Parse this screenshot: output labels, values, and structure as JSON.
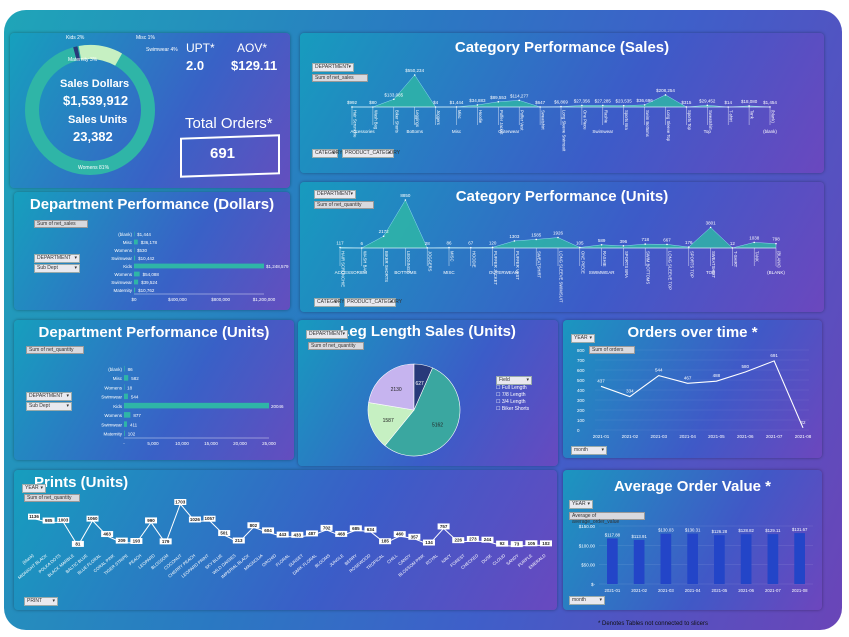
{
  "kpi": {
    "sales_dollars_label": "Sales Dollars",
    "sales_dollars_value": "$1,539,912",
    "sales_units_label": "Sales Units",
    "sales_units_value": "23,382",
    "upt_label": "UPT*",
    "upt_value": "2.0",
    "aov_label": "AOV*",
    "aov_value": "$129.11",
    "total_orders_label": "Total Orders*",
    "total_orders_value": "691",
    "donut_labels": [
      "Kids 2%",
      "Misc 1%",
      "Maternity 3%",
      "Swimwear 4%",
      "Womens 81%"
    ]
  },
  "panels": {
    "cat_sales_title": "Category Performance (Sales)",
    "cat_units_title": "Category Performance (Units)",
    "dept_dollars_title": "Department Performance (Dollars)",
    "dept_units_title": "Department Performance (Units)",
    "leg_title": "Leg Length Sales (Units)",
    "orders_title": "Orders over time *",
    "prints_title": "Prints (Units)",
    "aov_title": "Average Order Value *",
    "footnote": "* Denotes Tables not connected to slicers"
  },
  "slicers": {
    "department": "DEPARTMENT",
    "category": "CATEGORY",
    "product_category": "PRODUCT_CATEGORY",
    "sub_dept": "Sub Dept",
    "sum_net_sales": "Sum of net_sales",
    "sum_net_quantity": "Sum of net_quantity",
    "year": "YEAR",
    "month": "month",
    "print": "PRINT",
    "sum_orders": "Sum of orders",
    "avg_order_value": "Average of average_order_value",
    "filter_field": "Field"
  },
  "colors": {
    "teal": "#2fb5a7",
    "pie_teal": "#3aa7a0",
    "pie_green": "#c6f0c2",
    "pie_purple": "#c6b4ef",
    "pie_navy": "#283a7a",
    "bar_blue": "#2345c8",
    "line_white": "#ffffff"
  },
  "chart_data": [
    {
      "id": "category_sales",
      "type": "area",
      "title": "Category Performance (Sales)",
      "groups": [
        "Accessories",
        "Bottoms",
        "Misc",
        "Outerwear",
        "Swimwear",
        "Top",
        "(blank)"
      ],
      "categories": [
        "Hair Scrunchie",
        "Wash Bag",
        "Biker Shorts",
        "Leggings",
        "Joggers",
        "Misc",
        "Hoodie",
        "Puffer Jacket",
        "Puffer Vest",
        "Sweatshirt",
        "Long Sleeve Swimsuit",
        "One Piece",
        "Rashie",
        "Sports Bra",
        "Swim Bottoms",
        "Long Sleeve Top",
        "Sports Top",
        "Sweatshirt",
        "T-shirt",
        "Tank",
        "(blank)"
      ],
      "values": [
        992,
        80,
        133085,
        550234,
        4,
        1444,
        34883,
        89553,
        114277,
        647,
        6869,
        27356,
        27285,
        23535,
        36696,
        208254,
        315,
        29452,
        14,
        18080,
        1454
      ],
      "data_labels": [
        "$992",
        "$80",
        "$133,085",
        "$550,234",
        "$4",
        "$1,444",
        "$34,883",
        "$89,553",
        "$114,277",
        "$647",
        "$6,869",
        "$27,356",
        "$27,285",
        "$23,535",
        "$36,696",
        "$208,254",
        "$315",
        "$29,452",
        "$14",
        "$18,080",
        "$1,454"
      ],
      "series": [
        {
          "name": "Sum of net_sales"
        }
      ]
    },
    {
      "id": "category_units",
      "type": "area",
      "title": "Category Performance (Units)",
      "groups": [
        "ACCESSORIES",
        "BOTTOMS",
        "MISC",
        "OUTERWEAR",
        "SWIMWEAR",
        "TOP",
        "(BLANK)"
      ],
      "categories": [
        "HAIR SCRUNCHIE",
        "WASH BAG",
        "BIKER SHORTS",
        "LEGGINGS",
        "JOGGERS",
        "MISC",
        "HOODIE",
        "PUFFER JACKET",
        "PUFFER VEST",
        "SWEATSHIRT",
        "LONG SLEEVE SWIMSUIT",
        "ONE PIECE",
        "RASHIE",
        "SPORTS BRA",
        "SWIM BOTTOMS",
        "LONG SLEEVE TOP",
        "SPORTS TOP",
        "SWEATSHIRT",
        "T-SHIRT",
        "TANK",
        "(BLANK)"
      ],
      "values": [
        117,
        6,
        2172,
        8850,
        28,
        86,
        67,
        120,
        1303,
        1585,
        1926,
        105,
        589,
        396,
        718,
        667,
        176,
        3801,
        12,
        1038,
        798
      ],
      "series": [
        {
          "name": "Sum of net_quantity"
        }
      ]
    },
    {
      "id": "dept_dollars",
      "type": "bar",
      "title": "Department Performance (Dollars)",
      "categories": [
        "(blank)",
        "Misc",
        "Womens",
        "Swimwear",
        "Kids",
        "Womens",
        "Swimwear",
        "Maternity"
      ],
      "values": [
        1444,
        36178,
        530,
        10442,
        1248579,
        54088,
        39524,
        10762
      ],
      "data_labels": [
        "$1,444",
        "$36,178",
        "$530",
        "$10,442",
        "$1,248,579",
        "$54,088",
        "$39,524",
        "$10,762"
      ],
      "xticks": [
        "$0",
        "$400,000",
        "$800,000",
        "$1,200,000"
      ]
    },
    {
      "id": "dept_units",
      "type": "bar",
      "title": "Department Performance (Units)",
      "categories": [
        "(blank)",
        "Misc",
        "Womens",
        "Swimwear",
        "Kids",
        "Womens",
        "Swimwear",
        "Maternity"
      ],
      "values": [
        86,
        582,
        18,
        544,
        20046,
        877,
        411,
        102
      ],
      "xticks": [
        "-",
        "5,000",
        "10,000",
        "15,000",
        "20,000",
        "25,000"
      ]
    },
    {
      "id": "leg_length",
      "type": "pie",
      "title": "Leg Length Sales (Units)",
      "categories": [
        "Full Length",
        "7/8 Length",
        "3/4 Length",
        "Biker Shorts"
      ],
      "values": [
        5162,
        1587,
        2130,
        627
      ]
    },
    {
      "id": "orders_over_time",
      "type": "line",
      "title": "Orders over time *",
      "x": [
        "2021-01",
        "2021-02",
        "2021-03",
        "2021-04",
        "2021-05",
        "2021-06",
        "2021-07",
        "2021-08"
      ],
      "values": [
        437,
        334,
        544,
        467,
        488,
        580,
        691,
        22
      ],
      "yticks": [
        "0",
        "100",
        "200",
        "300",
        "400",
        "500",
        "600",
        "700",
        "800"
      ],
      "ylim": [
        0,
        800
      ]
    },
    {
      "id": "prints_units",
      "type": "line",
      "title": "Prints (Units)",
      "categories": [
        "(blank)",
        "MIDNIGHT BLACK",
        "POLKA DOTS",
        "BLACK MARBLE",
        "BALTIC BLUE",
        "BLUE FLORAL",
        "CORAL PINK",
        "TIGER STRIPE",
        "PEACH",
        "LEOPARD",
        "BLOSSOM",
        "COCONUT",
        "CHERRY PEACH",
        "LEOPARD PRINT",
        "SKY BLUE",
        "WILD DAISIES",
        "IMPERIAL BLACK",
        "MAGNOLIA",
        "ORCHID",
        "FLORAL",
        "SUNSET",
        "DARK FLORAL",
        "BLOOMS",
        "JUNGLE",
        "BERRY",
        "ROSEWOOD",
        "TROPICAL",
        "CHILL",
        "CANDY",
        "BLOSSOM PINK",
        "ROYAL",
        "NAVY",
        "FOREST",
        "CHECKED",
        "DUSK",
        "CLOUD",
        "SANDY",
        "PURPLE",
        "EMERALD"
      ],
      "values": [
        1136,
        985,
        1003,
        81,
        1060,
        463,
        209,
        193,
        990,
        179,
        1703,
        1026,
        1057,
        501,
        213,
        802,
        604,
        443,
        433,
        487,
        702,
        468,
        685,
        634,
        185,
        460,
        357,
        134,
        757,
        226,
        273,
        244,
        92,
        73,
        105,
        102
      ]
    },
    {
      "id": "average_order_value",
      "type": "bar",
      "title": "Average Order Value *",
      "x": [
        "2021-01",
        "2021-02",
        "2021-03",
        "2021-04",
        "2021-05",
        "2021-06",
        "2021-07",
        "2021-08"
      ],
      "values": [
        117.88,
        113.91,
        130.03,
        130.31,
        126.28,
        128.82,
        129.11,
        131.67
      ],
      "data_labels": [
        "$117.88",
        "$113.91",
        "$130.03",
        "$130.31",
        "$126.28",
        "$128.82",
        "$129.11",
        "$131.67"
      ],
      "yticks": [
        "$-",
        "$50.00",
        "$100.00",
        "$150.00"
      ],
      "ylim": [
        0,
        150
      ]
    }
  ]
}
